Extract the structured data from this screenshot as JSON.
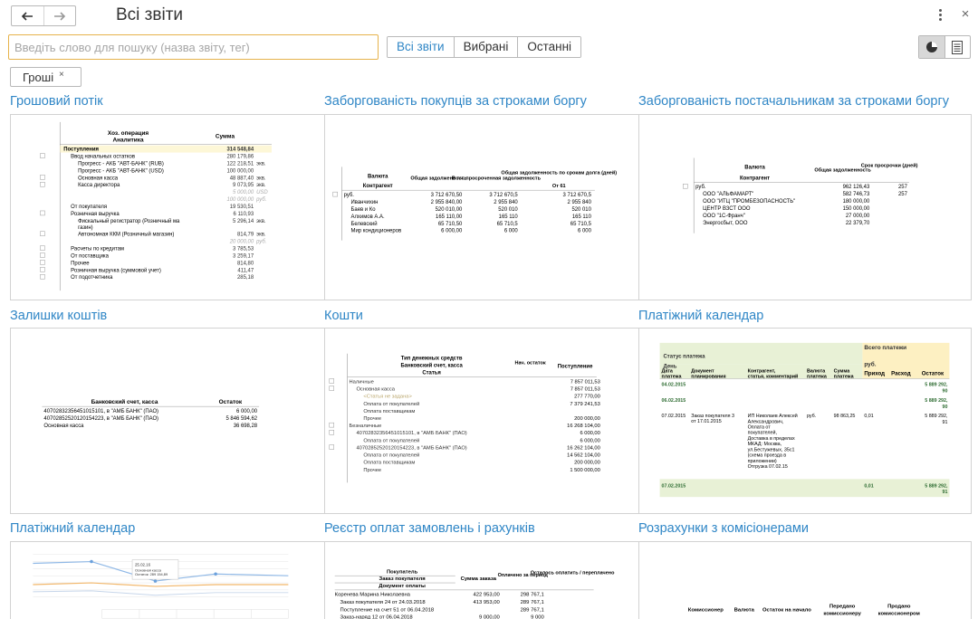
{
  "header": {
    "back_label": "back",
    "forward_label": "forward",
    "title": "Всі звіти"
  },
  "search": {
    "placeholder": "Введіть слово для пошуку (назва звіту, тег)",
    "value": ""
  },
  "filters": [
    {
      "label": "Всі звіти",
      "active": true
    },
    {
      "label": "Вибрані",
      "active": false
    },
    {
      "label": "Останні",
      "active": false
    }
  ],
  "tag": {
    "label": "Гроші",
    "remove": "×"
  },
  "icons": {
    "back": "arrow-left-icon",
    "forward": "arrow-right-icon",
    "more": "more-vertical-icon",
    "close": "close-icon",
    "thumbnails": "pie-chart-icon",
    "list": "list-icon"
  },
  "colors": {
    "accent": "#2f86c6",
    "search_border": "#e6b34b",
    "highlight": "#fdf7d7",
    "green_band": "#e8f1d6"
  },
  "reports": [
    {
      "title": "Грошовий потік",
      "preview": {
        "head": [
          "Хоз. операция",
          "Аналитика",
          "Сумма"
        ],
        "rows": [
          [
            "Поступления",
            "314 548,84",
            ""
          ],
          [
            "Ввод начальных остатков",
            "280 179,86",
            ""
          ],
          [
            "Прогресс - АКБ \"АВТ-БАНК\" (RUB)",
            "122 218,51",
            "экв."
          ],
          [
            "Прогресс - АКБ \"АВТ-БАНК\" (USD)",
            "100 000,00",
            ""
          ],
          [
            "Основная касса",
            "48 887,40",
            "экв."
          ],
          [
            "Касса директора",
            "9 073,95",
            "экв."
          ],
          [
            "",
            "5 000,00",
            "USD"
          ],
          [
            "",
            "100 000,00",
            "руб."
          ],
          [
            "От покупателя",
            "19 530,51",
            ""
          ],
          [
            "Розничная выручка",
            "6 110,93",
            ""
          ],
          [
            "Фискальный регистратор (Розничный магазин)",
            "5 296,14",
            "экв."
          ],
          [
            "Автономная ККМ (Розничный магазин)",
            "814,79",
            "экв."
          ],
          [
            "",
            "20 000,00",
            "руб."
          ],
          [
            "Расчеты по кредитам",
            "3 785,53",
            ""
          ],
          [
            "От поставщика",
            "3 259,17",
            ""
          ],
          [
            "Прочее",
            "814,80",
            ""
          ],
          [
            "Розничная выручка (суммовой учет)",
            "411,47",
            ""
          ],
          [
            "От подотчетника",
            "285,18",
            ""
          ]
        ]
      }
    },
    {
      "title": "Заборгованість покупців за строками боргу",
      "preview": {
        "head": [
          "Валюта",
          "Контрагент",
          "Общая задолженность",
          "В т.ч. просроченная задолженность",
          "Общая задолженность по срокам долга (дней)",
          "От 61"
        ],
        "rows": [
          [
            "руб.",
            "3 712 670,50",
            "3 712 670,5",
            "3 712 670,5"
          ],
          [
            "Иванчихин",
            "2 955 840,00",
            "2 955 840",
            "2 955 840"
          ],
          [
            "Баев и Ко",
            "520 010,00",
            "520 010",
            "520 010"
          ],
          [
            "Алхимов А.А.",
            "165 110,00",
            "165 110",
            "165 110"
          ],
          [
            "Белевский",
            "65 710,50",
            "65 710,5",
            "65 710,5"
          ],
          [
            "Мир кондиционеров",
            "6 000,00",
            "6 000",
            "6 000"
          ]
        ]
      }
    },
    {
      "title": "Заборгованість постачальникам за строками боргу",
      "preview": {
        "head": [
          "Валюта",
          "Контрагент",
          "Общая задолженность",
          "Срок просрочки (дней)"
        ],
        "rows": [
          [
            "руб.",
            "962 126,43",
            "257"
          ],
          [
            "ООО \"АЛЬФАМАРТ\"",
            "582 746,73",
            "257"
          ],
          [
            "ООО \"ИТЦ \"ПРОМБЕЗОПАСНОСТЬ\"",
            "180 000,00",
            ""
          ],
          [
            "ЦЕНТР ВЗСТ ООО",
            "150 000,00",
            ""
          ],
          [
            "ООО \"1С-Франч\"",
            "27 000,00",
            ""
          ],
          [
            "Энергосбыт, ООО",
            "22 379,70",
            ""
          ]
        ]
      }
    },
    {
      "title": "Залишки коштів",
      "preview": {
        "head": [
          "Банковский счет, касса",
          "Остаток"
        ],
        "rows": [
          [
            "40702832356451015101, в \"АМБ БАНК\" (ПАО)",
            "6 000,00"
          ],
          [
            "40702852520120154223, в \"АМБ БАНК\" (ПАО)",
            "5 846 594,62"
          ],
          [
            "Основная касса",
            "36 698,28"
          ]
        ]
      }
    },
    {
      "title": "Кошти",
      "preview": {
        "head": [
          "Тип денежных средств",
          "Банковский счет, касса",
          "Статья",
          "Нач. остаток",
          "Поступление"
        ],
        "rows": [
          [
            "Наличные",
            "7 857 011,53"
          ],
          [
            "Основная касса",
            "7 857 011,53"
          ],
          [
            "<Статья не задана>",
            "277 770,00"
          ],
          [
            "Оплата от покупателей",
            "7 379 241,53"
          ],
          [
            "Оплата поставщикам",
            ""
          ],
          [
            "Прочее",
            "200 000,00"
          ],
          [
            "Безналичные",
            "16 268 104,00"
          ],
          [
            "40702832356451015101, в \"АМБ БАНК\" (ПАО)",
            "6 000,00"
          ],
          [
            "Оплата от покупателей",
            "6 000,00"
          ],
          [
            "40702852520120154223, в \"АМБ БАНК\" (ПАО)",
            "16 262 104,00"
          ],
          [
            "Оплата от покупателей",
            "14 562 104,00"
          ],
          [
            "Оплата поставщикам",
            "200 000,00"
          ],
          [
            "Прочее",
            "1 500 000,00"
          ]
        ]
      }
    },
    {
      "title": "Платіжний календар",
      "preview": {
        "status_label": "Статус платежа",
        "day_label": "День",
        "group_label": "Всего платежи",
        "currency": "руб.",
        "cols": [
          "Дата платежа",
          "Документ планирования",
          "Контрагент, статья, комментарий",
          "Валюта платежа",
          "Сумма платежа",
          "Приход",
          "Расход",
          "Остаток"
        ],
        "rows": [
          [
            "04.02.2015",
            "5 889 292, 90"
          ],
          [
            "06.02.2015",
            "5 889 292, 90"
          ],
          [
            "07.02.2015",
            "Заказ покупателя 3 от 17.01.2015",
            "ИП Николаев Алексей Александрович, Оплата от покупателей, Доставка в пределах МКАД: Москва, ул.Бестужевых, 35с1 (схема проезда в приложении) Отгрузка 07.02.15",
            "руб.",
            "98 863,25",
            "0,01",
            "5 889 292, 91"
          ],
          [
            "07.02.2015",
            "0,01",
            "5 889 292, 91"
          ]
        ]
      }
    },
    {
      "title": "Платіжний календар",
      "preview": {
        "tooltip_date": "25.02.16",
        "tooltip_line1": "Основная касса",
        "tooltip_line2": "Остаток: 289 154,89"
      }
    },
    {
      "title": "Реєстр оплат замовлень і рахунків",
      "preview": {
        "head": [
          "Покупатель",
          "Заказ покупателя",
          "Документ оплаты",
          "Сумма заказа",
          "Оплачено за период",
          "Осталось оплатить / переплачено"
        ],
        "rows": [
          [
            "Коренева Марина Николаевна",
            "422 953,00",
            "298 767,1",
            ""
          ],
          [
            "Заказ покупателя 24 от 24.03.2018",
            "413 953,00",
            "289 767,1",
            ""
          ],
          [
            "Поступление на счет 51 от 06.04.2018",
            "",
            "289 767,1",
            ""
          ],
          [
            "Заказ-наряд 12 от 06.04.2018",
            "9 000,00",
            "9 000",
            ""
          ]
        ]
      }
    },
    {
      "title": "Розрахунки з комісіонерами",
      "preview": {
        "head": [
          "Комиссионер",
          "Валюта",
          "Остаток на начало",
          "Передано комиссионеру",
          "Продано комиссионером"
        ]
      }
    }
  ]
}
